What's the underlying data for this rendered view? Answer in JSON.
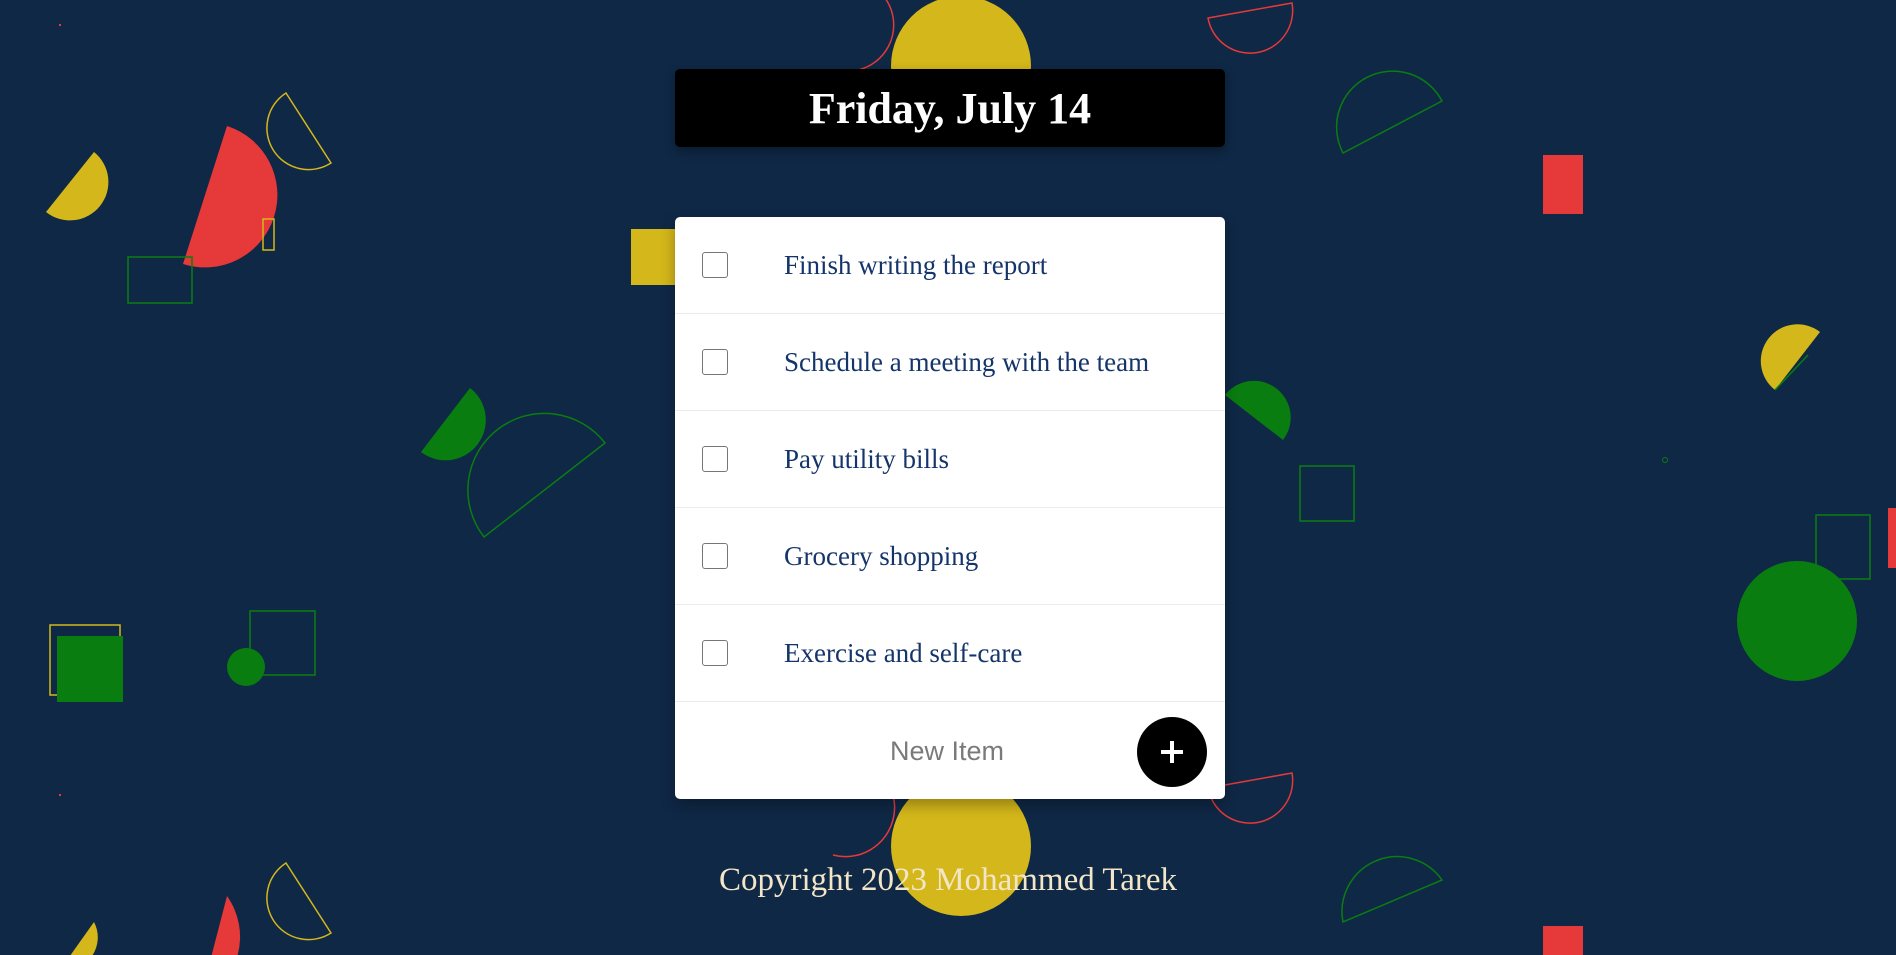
{
  "header": {
    "date_title": "Friday, July 14"
  },
  "todo": {
    "items": [
      {
        "label": "Finish writing the report",
        "checked": false
      },
      {
        "label": "Schedule a meeting with the team",
        "checked": false
      },
      {
        "label": "Pay utility bills",
        "checked": false
      },
      {
        "label": "Grocery shopping",
        "checked": false
      },
      {
        "label": "Exercise and self-care",
        "checked": false
      }
    ],
    "new_item": {
      "placeholder": "New Item",
      "value": "",
      "add_icon": "plus-icon"
    }
  },
  "footer": {
    "copyright": "Copyright 2023 Mohammed Tarek"
  },
  "theme": {
    "background": "#0f2846",
    "header_bg": "#000000",
    "card_bg": "#ffffff",
    "item_text": "#14346a",
    "footer_text": "#f3e6c8",
    "shape_yellow": "#d4b71a",
    "shape_red": "#e63939",
    "shape_green": "#0a7d10"
  }
}
